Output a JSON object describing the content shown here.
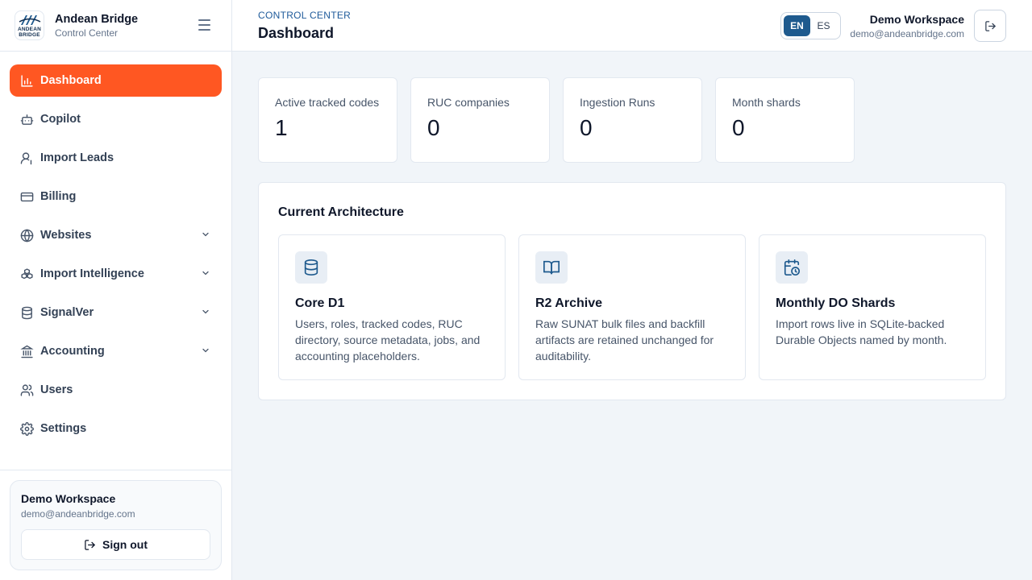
{
  "brand": {
    "name": "Andean Bridge",
    "subtitle": "Control Center",
    "logo_line1": "ANDEAN",
    "logo_line2": "BRIDGE"
  },
  "sidebar": {
    "items": [
      {
        "label": "Dashboard",
        "icon": "bar-chart-icon",
        "active": true
      },
      {
        "label": "Copilot",
        "icon": "bot-icon"
      },
      {
        "label": "Import Leads",
        "icon": "user-icon"
      },
      {
        "label": "Billing",
        "icon": "credit-card-icon"
      },
      {
        "label": "Websites",
        "icon": "globe-icon",
        "expandable": true
      },
      {
        "label": "Import Intelligence",
        "icon": "boxes-icon",
        "expandable": true
      },
      {
        "label": "SignalVer",
        "icon": "database-icon",
        "expandable": true
      },
      {
        "label": "Accounting",
        "icon": "landmark-icon",
        "expandable": true
      },
      {
        "label": "Users",
        "icon": "users-icon"
      },
      {
        "label": "Settings",
        "icon": "gear-icon"
      }
    ],
    "footer": {
      "workspace": "Demo Workspace",
      "email": "demo@andeanbridge.com",
      "signout_label": "Sign out"
    }
  },
  "header": {
    "breadcrumb": "CONTROL CENTER",
    "title": "Dashboard",
    "lang_en": "EN",
    "lang_es": "ES",
    "workspace": "Demo Workspace",
    "email": "demo@andeanbridge.com"
  },
  "stats": [
    {
      "label": "Active tracked codes",
      "value": "1"
    },
    {
      "label": "RUC companies",
      "value": "0"
    },
    {
      "label": "Ingestion Runs",
      "value": "0"
    },
    {
      "label": "Month shards",
      "value": "0"
    }
  ],
  "architecture": {
    "title": "Current Architecture",
    "cards": [
      {
        "name": "Core D1",
        "icon": "database-icon",
        "desc": "Users, roles, tracked codes, RUC directory, source metadata, jobs, and accounting placeholders."
      },
      {
        "name": "R2 Archive",
        "icon": "book-open-icon",
        "desc": "Raw SUNAT bulk files and backfill artifacts are retained unchanged for auditability."
      },
      {
        "name": "Monthly DO Shards",
        "icon": "calendar-clock-icon",
        "desc": "Import rows live in SQLite-backed Durable Objects named by month."
      }
    ]
  },
  "colors": {
    "accent": "#ff5722",
    "primary": "#1e5a8e",
    "background": "#f1f5f9"
  }
}
